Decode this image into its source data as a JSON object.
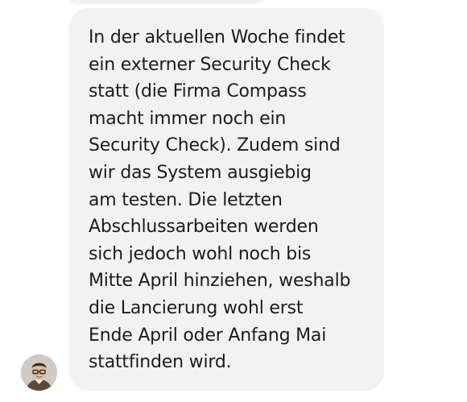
{
  "conversation": {
    "previous_message": {
      "text": ""
    },
    "message": {
      "text": "In der aktuellen Woche findet\nein externer Security Check\nstatt (die Firma Compass\nmacht immer noch ein\nSecurity Check). Zudem sind\nwir das System ausgiebig\nam testen. Die letzten\nAbschlussarbeiten werden\nsich jedoch wohl noch bis\nMitte April hinziehen, weshalb\ndie Lancierung wohl erst\nEnde April oder Anfang Mai\nstattfinden wird.",
      "bubble_color": "#f2f2f2",
      "text_color": "#1c1c1c"
    },
    "sender": {
      "avatar_icon": "user-avatar"
    }
  }
}
